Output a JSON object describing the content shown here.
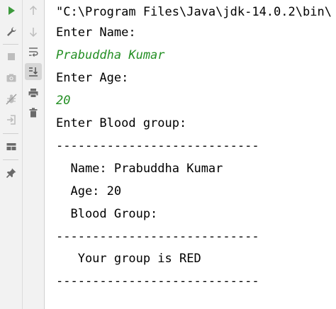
{
  "toolbar_left": {
    "icons": [
      "run-icon",
      "wrench-icon",
      "stop-icon",
      "camera-icon",
      "debug-disabled-icon",
      "exit-icon",
      "layout-icon",
      "pin-icon"
    ]
  },
  "toolbar_right": {
    "icons": [
      "up-arrow-icon",
      "down-arrow-icon",
      "soft-wrap-icon",
      "scroll-to-end-icon",
      "print-icon",
      "trash-icon"
    ],
    "active": "scroll-to-end-icon"
  },
  "console": {
    "input_color": "#248f24",
    "lines": [
      "\"C:\\Program Files\\Java\\jdk-14.0.2\\bin\\",
      "Enter Name:",
      "Prabuddha Kumar",
      "Enter Age:",
      "20",
      "Enter Blood group:",
      "----------------------------",
      "  Name: Prabuddha Kumar",
      "  Age: 20",
      "  Blood Group:",
      "----------------------------",
      "   Your group is RED",
      "----------------------------"
    ]
  }
}
